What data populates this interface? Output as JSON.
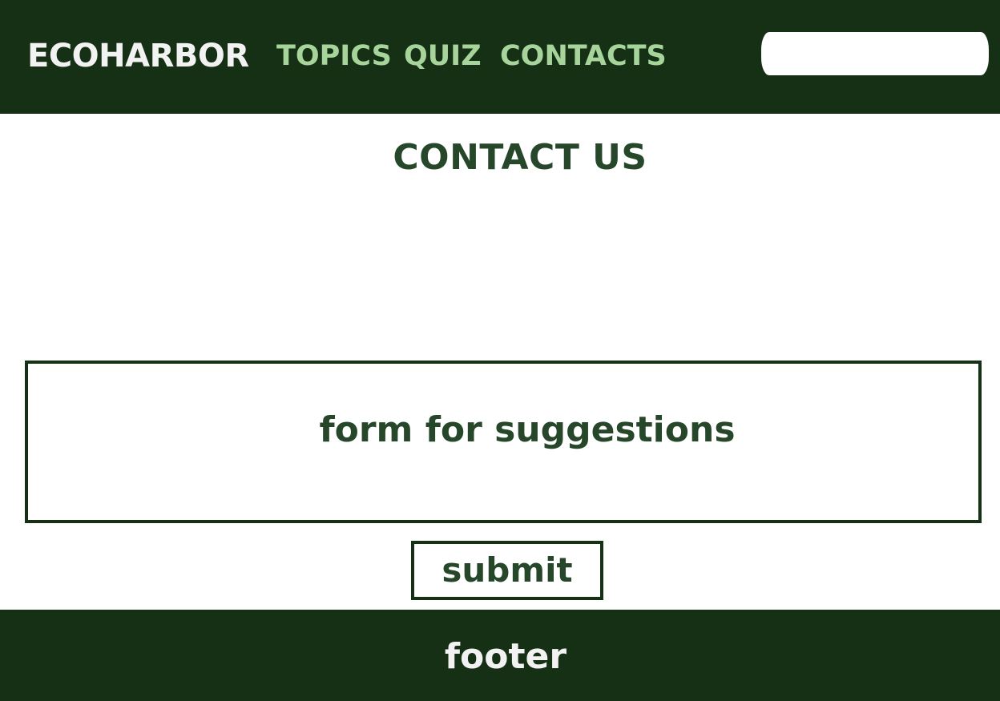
{
  "header": {
    "logo": "ECOHARBOR",
    "nav": {
      "topics": "TOPICS",
      "quiz": "QUIZ",
      "contacts": "CONTACTS"
    },
    "search": {
      "value": "",
      "placeholder": ""
    }
  },
  "main": {
    "title": "CONTACT US",
    "form_label": "form for suggestions",
    "submit_label": "submit"
  },
  "footer": {
    "text": "footer"
  },
  "colors": {
    "header_bg": "#163016",
    "nav_link": "#a6d49a",
    "heading_text": "#26472a",
    "logo_text": "#f2f2f2",
    "background": "#ffffff"
  }
}
